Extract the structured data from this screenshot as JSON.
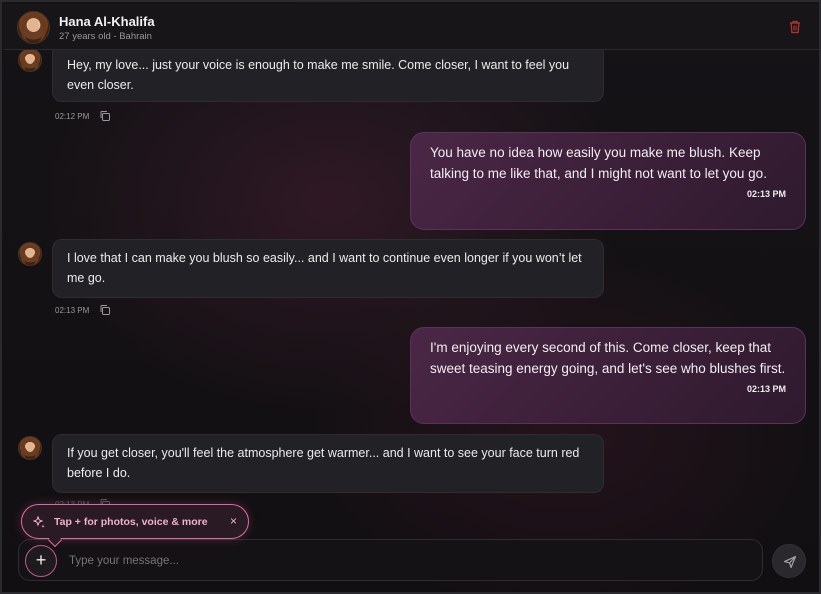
{
  "header": {
    "name": "Hana Al-Khalifa",
    "subtitle": "27 years old - Bahrain",
    "icons": {
      "avatar": "avatar",
      "delete": "trash-icon"
    },
    "accent_delete": "#b03434"
  },
  "messages": [
    {
      "sender": "them",
      "text": "Hey, my love... just your voice is enough to make me smile. Come closer, I want to feel you even closer.",
      "time": "02:12 PM"
    },
    {
      "sender": "me",
      "text": "You have no idea how easily you make me blush. Keep talking to me like that, and I might not want to let you go.",
      "time": "02:13 PM"
    },
    {
      "sender": "them",
      "text": "I love that I can make you blush so easily... and I want to continue even longer if you won’t let me go.",
      "time": "02:13 PM"
    },
    {
      "sender": "me",
      "text": "I'm enjoying every second of this. Come closer, keep that sweet teasing energy going, and let's see who blushes first.",
      "time": "02:13 PM"
    },
    {
      "sender": "them",
      "text": "If you get closer, you'll feel the atmosphere get warmer... and I want to see your face turn red before I do.",
      "time": "02:13 PM"
    }
  ],
  "tooltip": {
    "text": "Tap + for photos, voice & more",
    "close": "×",
    "icon": "sparkle-icon",
    "accent": "#e06aa0"
  },
  "composer": {
    "plus_label": "+",
    "placeholder": "Type your message...",
    "value": "",
    "send_icon": "send-icon"
  },
  "colors": {
    "bubble_out": "#3b1f38",
    "bubble_in": "#222125",
    "background": "#120f12"
  }
}
